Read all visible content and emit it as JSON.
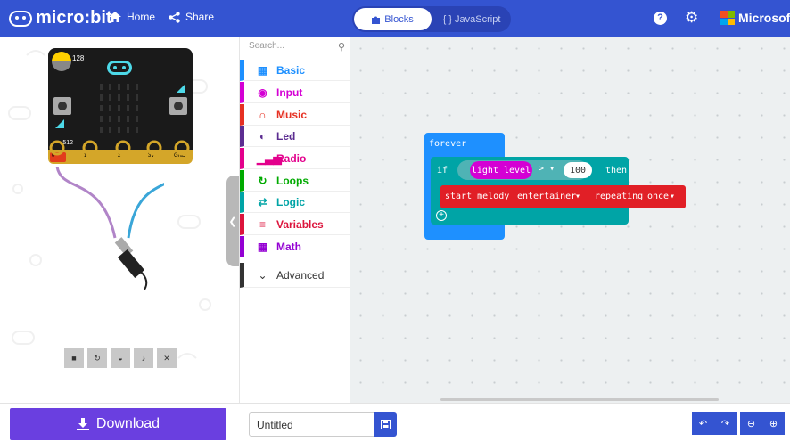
{
  "header": {
    "logo_text": "micro:bit",
    "home_label": "Home",
    "share_label": "Share",
    "blocks_label": "Blocks",
    "javascript_label": "JavaScript",
    "microsoft_label": "Microsoft",
    "help_icon": "?",
    "colors": {
      "bar": "#3454d1",
      "ms_red": "#f25022",
      "ms_green": "#7fba00",
      "ms_blue": "#00a4ef",
      "ms_yellow": "#ffb900"
    }
  },
  "simulator": {
    "light_value": "128",
    "pin_value": "-512",
    "pins": [
      "0",
      "1",
      "2",
      "3V",
      "GND"
    ],
    "controls": [
      "stop-icon",
      "restart-icon",
      "slowmo-icon",
      "mute-icon",
      "fullscreen-icon"
    ]
  },
  "toolbox": {
    "search_placeholder": "Search...",
    "categories": [
      {
        "label": "Basic",
        "color": "#1e90ff",
        "icon": "grid-icon"
      },
      {
        "label": "Input",
        "color": "#d400d4",
        "icon": "target-icon"
      },
      {
        "label": "Music",
        "color": "#e63022",
        "icon": "headphones-icon"
      },
      {
        "label": "Led",
        "color": "#5c2d91",
        "icon": "toggle-icon"
      },
      {
        "label": "Radio",
        "color": "#e3008c",
        "icon": "signal-icon"
      },
      {
        "label": "Loops",
        "color": "#00aa00",
        "icon": "refresh-icon"
      },
      {
        "label": "Logic",
        "color": "#00a4a6",
        "icon": "shuffle-icon"
      },
      {
        "label": "Variables",
        "color": "#dc143c",
        "icon": "list-icon"
      },
      {
        "label": "Math",
        "color": "#9400d3",
        "icon": "calculator-icon"
      }
    ],
    "advanced_label": "Advanced"
  },
  "workspace": {
    "forever_label": "forever",
    "if_label": "if",
    "sensor_label": "light level",
    "operator_label": ">",
    "threshold_value": "100",
    "then_label": "then",
    "melody_label": "start melody",
    "melody_value": "entertainer",
    "repeating_label": "repeating",
    "repeat_value": "once"
  },
  "footer": {
    "download_label": "Download",
    "project_name": "Untitled"
  }
}
